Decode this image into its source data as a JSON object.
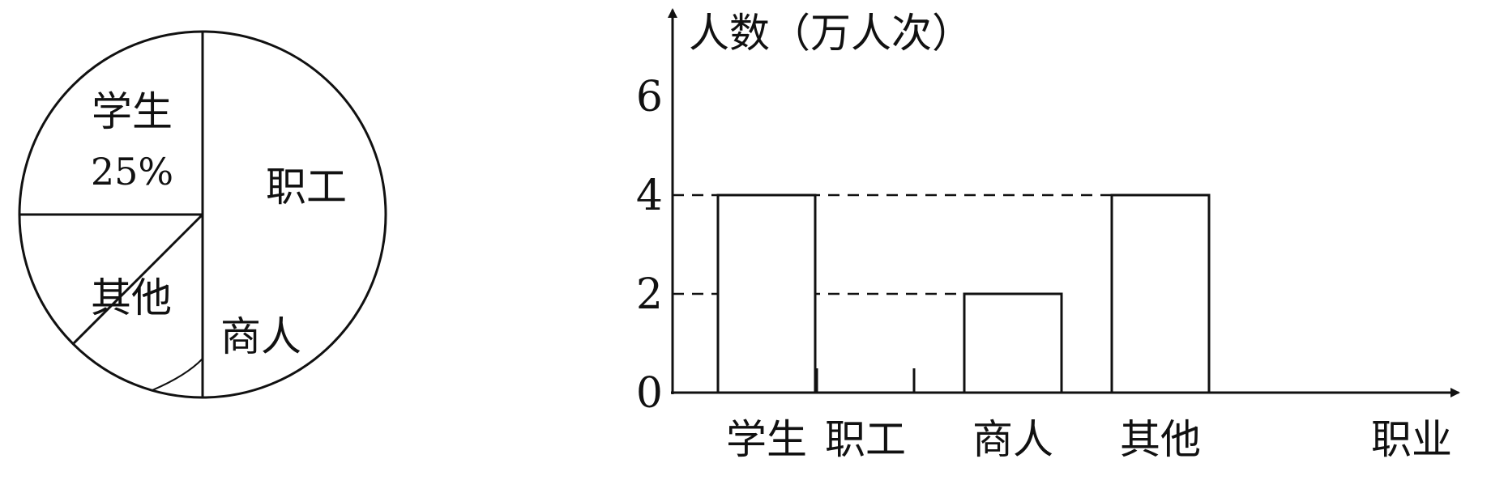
{
  "chart_data": [
    {
      "type": "pie",
      "slices": [
        {
          "label": "学生",
          "percent_label": "25%",
          "value": 0.25
        },
        {
          "label": "职工",
          "percent_label": "",
          "value": 0.5
        },
        {
          "label": "商人",
          "percent_label": "",
          "value": 0.125
        },
        {
          "label": "其他",
          "percent_label": "",
          "value": 0.125
        }
      ]
    },
    {
      "type": "bar",
      "ylabel": "人数（万人次）",
      "xlabel": "职业",
      "categories": [
        "学生",
        "职工",
        "商人",
        "其他"
      ],
      "values": [
        4,
        null,
        2,
        4
      ],
      "yticks": [
        0,
        2,
        4,
        6
      ],
      "ylim": [
        0,
        7
      ],
      "dashed_reference_levels": [
        4,
        2
      ]
    }
  ]
}
